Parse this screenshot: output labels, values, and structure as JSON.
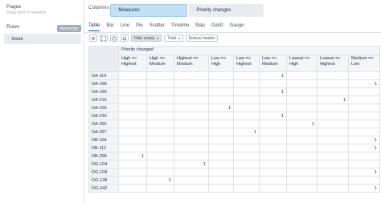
{
  "pages": {
    "label": "Pages",
    "placeholder": "Drag here if needed"
  },
  "rows": {
    "label": "Rows",
    "nonempty_label": "Nonempty",
    "chip_label": "Issue"
  },
  "columns": {
    "label": "Columns",
    "chips": [
      "Measures",
      "Priority changes"
    ]
  },
  "tabs": [
    "Table",
    "Bar",
    "Line",
    "Pie",
    "Scatter",
    "Timeline",
    "Map",
    "Gantt",
    "Gauge"
  ],
  "toolbar": {
    "hide_empty": "Hide empty",
    "total": "Total",
    "freeze_header": "Freeze header"
  },
  "table": {
    "group_header": "Priority changed",
    "columns": [
      "High => Highest",
      "High => Medium",
      "Highest => Medium",
      "Low => High",
      "Low => Highest",
      "Low => Medium",
      "Lowest => High",
      "Lowest => Highest",
      "Medium => Low"
    ],
    "rows": [
      {
        "label": "DA-114",
        "values": [
          "",
          "",
          "",
          "",
          "",
          "1",
          "",
          "",
          ""
        ]
      },
      {
        "label": "DA-198",
        "values": [
          "",
          "",
          "",
          "",
          "",
          "",
          "",
          "",
          "1"
        ]
      },
      {
        "label": "DA-199",
        "values": [
          "",
          "",
          "",
          "",
          "",
          "1",
          "",
          "",
          ""
        ]
      },
      {
        "label": "DA-215",
        "values": [
          "",
          "",
          "",
          "",
          "",
          "",
          "",
          "1",
          ""
        ]
      },
      {
        "label": "DA-229",
        "values": [
          "",
          "",
          "",
          "1",
          "",
          "",
          "",
          "",
          ""
        ]
      },
      {
        "label": "DA-230",
        "values": [
          "",
          "",
          "",
          "",
          "",
          "1",
          "",
          "",
          ""
        ]
      },
      {
        "label": "DA-255",
        "values": [
          "",
          "",
          "",
          "",
          "",
          "",
          "1",
          "",
          ""
        ]
      },
      {
        "label": "DA-257",
        "values": [
          "",
          "",
          "",
          "",
          "1",
          "",
          "",
          "",
          ""
        ]
      },
      {
        "label": "DB-104",
        "values": [
          "",
          "",
          "",
          "",
          "",
          "",
          "",
          "",
          "1"
        ]
      },
      {
        "label": "DB-112",
        "values": [
          "",
          "",
          "",
          "",
          "",
          "",
          "",
          "",
          "1"
        ]
      },
      {
        "label": "DB-258",
        "values": [
          "1",
          "",
          "",
          "",
          "",
          "",
          "",
          "",
          ""
        ]
      },
      {
        "label": "DG-104",
        "values": [
          "",
          "",
          "1",
          "",
          "",
          "",
          "",
          "",
          ""
        ]
      },
      {
        "label": "DG-109",
        "values": [
          "",
          "",
          "",
          "",
          "",
          "",
          "",
          "",
          "1"
        ]
      },
      {
        "label": "DG-138",
        "values": [
          "",
          "1",
          "",
          "",
          "",
          "",
          "",
          "",
          ""
        ]
      },
      {
        "label": "DG-242",
        "values": [
          "",
          "",
          "",
          "",
          "",
          "",
          "",
          "",
          "1"
        ]
      }
    ]
  }
}
